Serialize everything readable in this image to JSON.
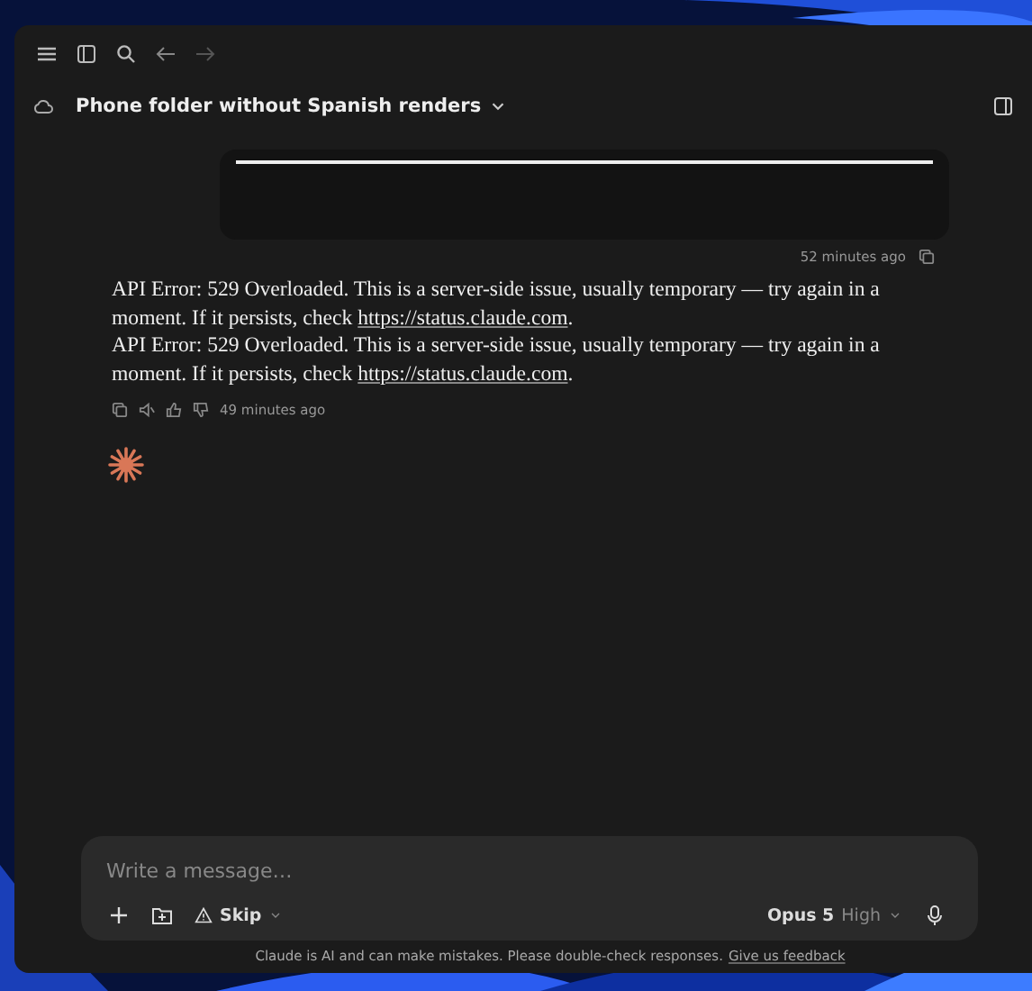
{
  "toolbar": {
    "title": "Phone folder without Spanish renders"
  },
  "user_message": {
    "time": "52 minutes ago"
  },
  "assistant_message": {
    "paragraphs": [
      {
        "before": "API Error: 529 Overloaded. This is a server-side issue, usually temporary — try again in a moment. If it persists, check ",
        "link": "https://status.claude.com",
        "after": "."
      },
      {
        "before": "API Error: 529 Overloaded. This is a server-side issue, usually temporary — try again in a moment. If it persists, check ",
        "link": "https://status.claude.com",
        "after": "."
      }
    ],
    "time": "49 minutes ago"
  },
  "composer": {
    "placeholder": "Write a message…",
    "mode": "Skip",
    "model": "Opus 5",
    "effort": "High"
  },
  "footer": {
    "text": "Claude is AI and can make mistakes. Please double-check responses.",
    "link": "Give us feedback"
  }
}
